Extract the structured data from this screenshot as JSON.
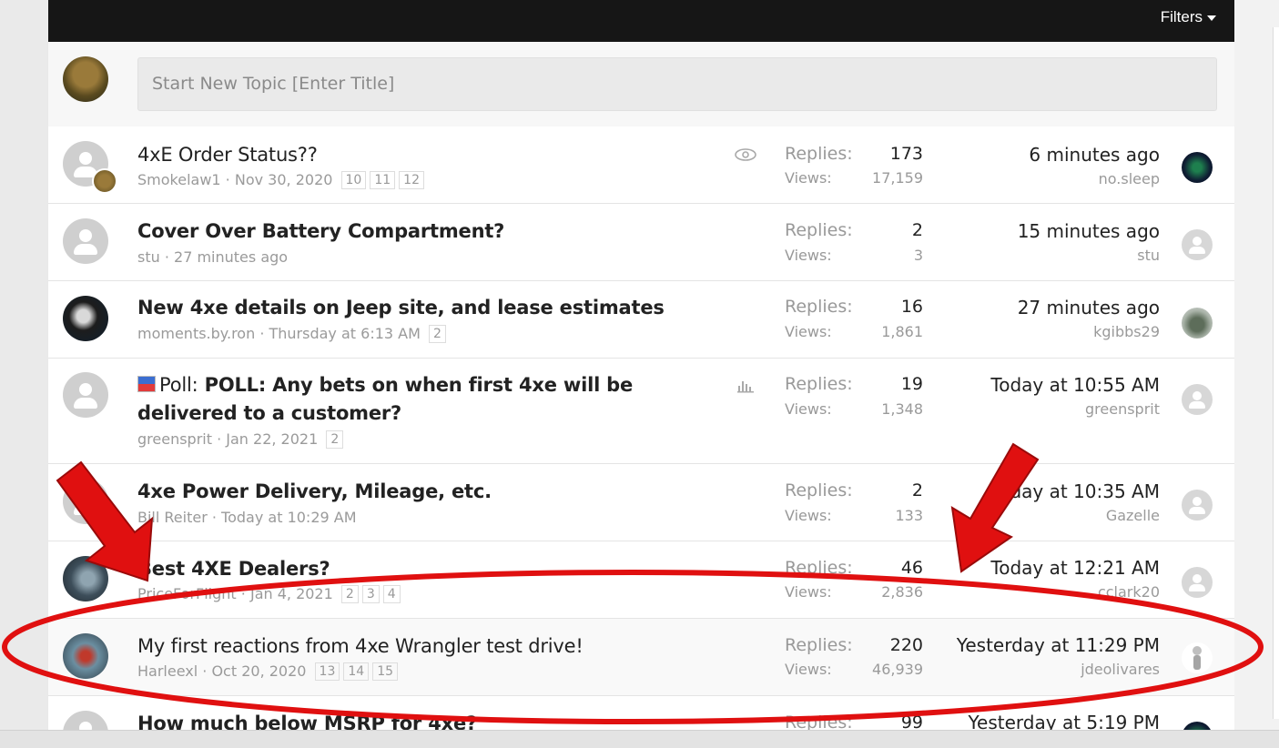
{
  "header": {
    "filters_label": "Filters"
  },
  "new_topic": {
    "placeholder": "Start New Topic [Enter Title]"
  },
  "labels": {
    "replies": "Replies:",
    "views": "Views:"
  },
  "threads": [
    {
      "title": "4xE Order Status??",
      "author": "Smokelaw1",
      "date": "Nov 30, 2020",
      "pages": [
        "10",
        "11",
        "12"
      ],
      "replies": "173",
      "views": "17,159",
      "last_time": "6 minutes ago",
      "last_user": "no.sleep",
      "status_icon": "eye-icon"
    },
    {
      "title": "Cover Over Battery Compartment?",
      "author": "stu",
      "date": "27 minutes ago",
      "pages": [],
      "replies": "2",
      "views": "3",
      "last_time": "15 minutes ago",
      "last_user": "stu"
    },
    {
      "title": "New 4xe details on Jeep site, and lease estimates",
      "author": "moments.by.ron",
      "date": "Thursday at 6:13 AM",
      "pages": [
        "2"
      ],
      "replies": "16",
      "views": "1,861",
      "last_time": "27 minutes ago",
      "last_user": "kgibbs29"
    },
    {
      "prefix": "Poll:",
      "title": "POLL: Any bets on when first 4xe will be delivered to a customer?",
      "author": "greensprit",
      "date": "Jan 22, 2021",
      "pages": [
        "2"
      ],
      "replies": "19",
      "views": "1,348",
      "last_time": "Today at 10:55 AM",
      "last_user": "greensprit",
      "status_icon": "poll-chart-icon"
    },
    {
      "title": "4xe Power Delivery, Mileage, etc.",
      "author": "Bill Reiter",
      "date": "Today at 10:29 AM",
      "pages": [],
      "replies": "2",
      "views": "133",
      "last_time": "Today at 10:35 AM",
      "last_user": "Gazelle"
    },
    {
      "title": "Best 4XE Dealers?",
      "author": "PriceForFlight",
      "date": "Jan 4, 2021",
      "pages": [
        "2",
        "3",
        "4"
      ],
      "replies": "46",
      "views": "2,836",
      "last_time": "Today at 12:21 AM",
      "last_user": "cclark20"
    },
    {
      "title": "My first reactions from 4xe Wrangler test drive!",
      "author": "Harleexl",
      "date": "Oct 20, 2020",
      "pages": [
        "13",
        "14",
        "15"
      ],
      "replies": "220",
      "views": "46,939",
      "last_time": "Yesterday at 11:29 PM",
      "last_user": "jdeolivares"
    },
    {
      "title": "How much below MSRP for 4xe?",
      "replies": "99",
      "last_time": "Yesterday at 5:19 PM"
    }
  ],
  "colors": {
    "annotation": "#e01010",
    "header_bg": "#161616"
  }
}
